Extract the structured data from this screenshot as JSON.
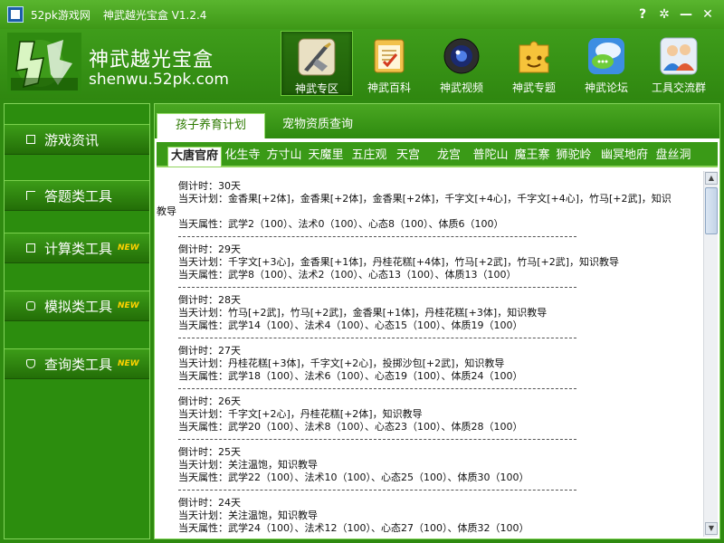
{
  "window": {
    "site_name": "52pk游戏网",
    "title": "神武越光宝盒 V1.2.4",
    "help_label": "?",
    "settings_label": "✲",
    "minimize_label": "—",
    "close_label": "✕"
  },
  "brand": {
    "name": "神武越光宝盒",
    "url": "shenwu.52pk.com"
  },
  "nav": [
    {
      "label": "神武专区",
      "icon": "sword-shield-icon",
      "active": true
    },
    {
      "label": "神武百科",
      "icon": "notepad-icon"
    },
    {
      "label": "神武视频",
      "icon": "camera-lens-icon"
    },
    {
      "label": "神武专题",
      "icon": "puzzle-icon"
    },
    {
      "label": "神武论坛",
      "icon": "chat-bubbles-icon"
    },
    {
      "label": "工具交流群",
      "icon": "users-icon"
    }
  ],
  "sidebar": [
    {
      "label": "游戏资讯",
      "icon": "news-icon"
    },
    {
      "label": "答题类工具",
      "icon": "flag-icon"
    },
    {
      "label": "计算类工具",
      "icon": "calculator-icon",
      "badge": "NEW"
    },
    {
      "label": "模拟类工具",
      "icon": "gamepad-icon",
      "badge": "NEW"
    },
    {
      "label": "查询类工具",
      "icon": "thumbs-up-icon",
      "badge": "NEW"
    }
  ],
  "tabs": [
    "孩子养育计划",
    "宠物资质查询"
  ],
  "subtabs": [
    "大唐官府",
    "化生寺",
    "方寸山",
    "天魔里",
    "五庄观",
    "天宫",
    "龙宫",
    "普陀山",
    "魔王寨",
    "狮驼岭",
    "幽冥地府",
    "盘丝洞"
  ],
  "separator": "--------------------------------------------------------------------------------",
  "entries": [
    {
      "countdown": "倒计时：30天",
      "plan": "当天计划：金香果[+2体]，金香果[+2体]，金香果[+2体]，千字文[+4心]，千字文[+4心]，竹马[+2武]，知识",
      "plan_wrap": "教导",
      "attr": "当天属性：武学2（100）、法术0（100）、心态8（100）、体质6（100）"
    },
    {
      "countdown": "倒计时：29天",
      "plan": "当天计划：千字文[+3心]，金香果[+1体]，丹桂花糕[+4体]，竹马[+2武]，竹马[+2武]，知识教导",
      "attr": "当天属性：武学8（100）、法术2（100）、心态13（100）、体质13（100）"
    },
    {
      "countdown": "倒计时：28天",
      "plan": "当天计划：竹马[+2武]，竹马[+2武]，金香果[+1体]，丹桂花糕[+3体]，知识教导",
      "attr": "当天属性：武学14（100）、法术4（100）、心态15（100）、体质19（100）"
    },
    {
      "countdown": "倒计时：27天",
      "plan": "当天计划：丹桂花糕[+3体]，千字文[+2心]，投掷沙包[+2武]，知识教导",
      "attr": "当天属性：武学18（100）、法术6（100）、心态19（100）、体质24（100）"
    },
    {
      "countdown": "倒计时：26天",
      "plan": "当天计划：千字文[+2心]，丹桂花糕[+2体]，知识教导",
      "attr": "当天属性：武学20（100）、法术8（100）、心态23（100）、体质28（100）"
    },
    {
      "countdown": "倒计时：25天",
      "plan": "当天计划：关注温饱，知识教导",
      "attr": "当天属性：武学22（100）、法术10（100）、心态25（100）、体质30（100）"
    },
    {
      "countdown": "倒计时：24天",
      "plan": "当天计划：关注温饱，知识教导",
      "attr": "当天属性：武学24（100）、法术12（100）、心态27（100）、体质32（100）"
    }
  ]
}
